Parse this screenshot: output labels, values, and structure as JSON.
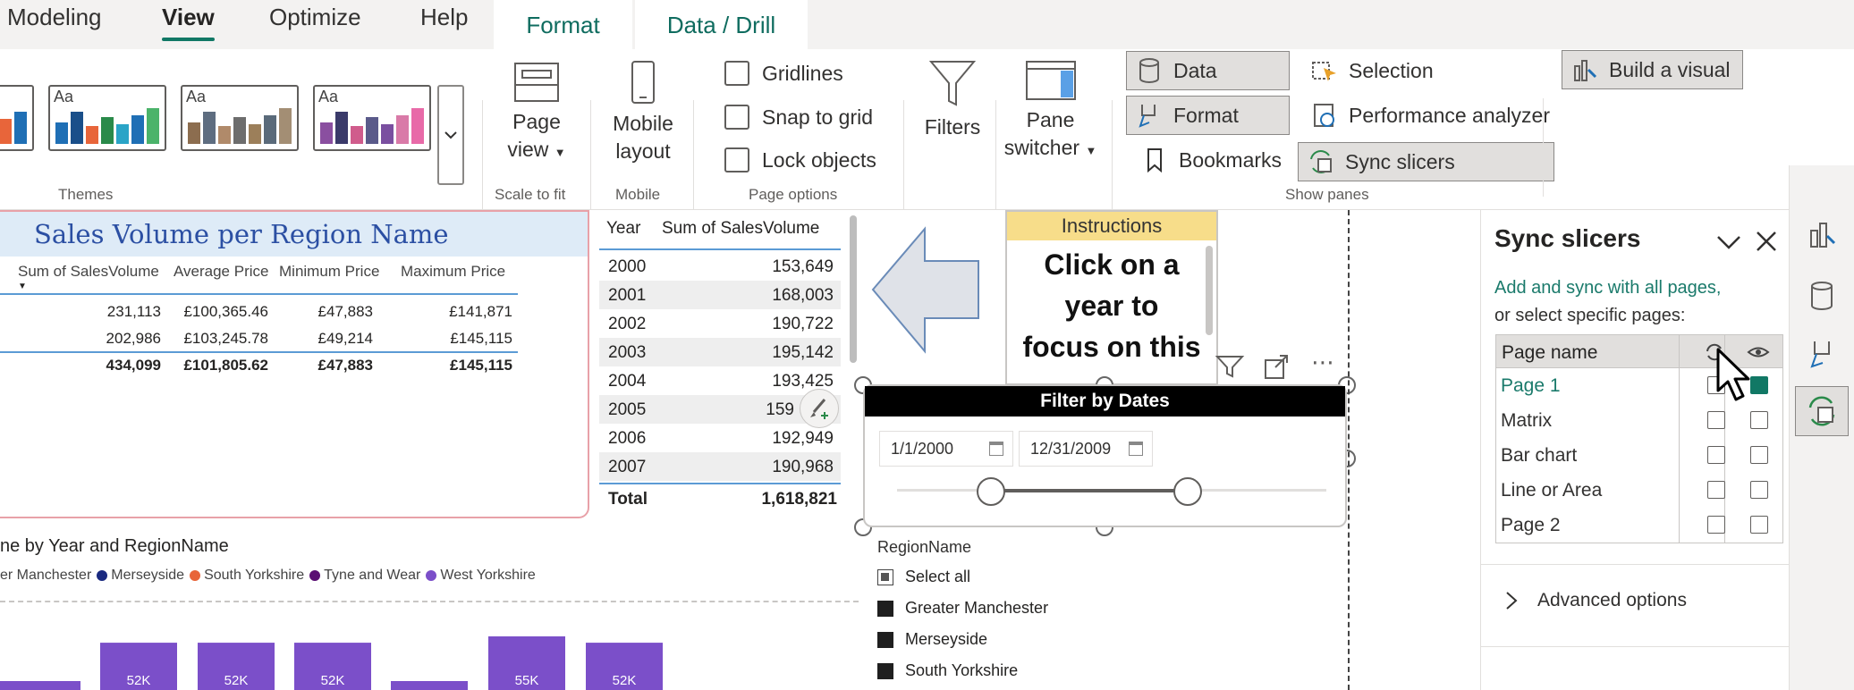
{
  "menu": {
    "tabs": [
      "Modeling",
      "View",
      "Optimize",
      "Help"
    ],
    "context_tabs": [
      "Format",
      "Data / Drill"
    ]
  },
  "ribbon": {
    "groups": {
      "themes": "Themes",
      "scale_to_fit": "Scale to fit",
      "mobile": "Mobile",
      "page_options": "Page options",
      "show_panes": "Show panes"
    },
    "theme_thumb_text": "Aa",
    "page_view": [
      "Page",
      "view"
    ],
    "mobile_layout": [
      "Mobile",
      "layout"
    ],
    "checkboxes": [
      "Gridlines",
      "Snap to grid",
      "Lock objects"
    ],
    "filters": "Filters",
    "pane_switcher": [
      "Pane",
      "switcher"
    ],
    "panes": {
      "data": "Data",
      "format": "Format",
      "bookmarks": "Bookmarks",
      "selection": "Selection",
      "performance": "Performance analyzer",
      "sync_slicers": "Sync slicers",
      "build_visual": "Build a visual"
    }
  },
  "matrix": {
    "title": "Sales Volume per Region Name",
    "headers": [
      "Sum of SalesVolume",
      "Average Price",
      "Minimum Price",
      "Maximum Price"
    ],
    "rows": [
      [
        "231,113",
        "£100,365.46",
        "£47,883",
        "£141,871"
      ],
      [
        "202,986",
        "£103,245.78",
        "£49,214",
        "£145,115"
      ]
    ],
    "total": [
      "434,099",
      "£101,805.62",
      "£47,883",
      "£145,115"
    ]
  },
  "year_table": {
    "headers": [
      "Year",
      "Sum of SalesVolume"
    ],
    "rows": [
      [
        "2000",
        "153,649"
      ],
      [
        "2001",
        "168,003"
      ],
      [
        "2002",
        "190,722"
      ],
      [
        "2003",
        "195,142"
      ],
      [
        "2004",
        "193,425"
      ],
      [
        "2005",
        "159"
      ],
      [
        "2006",
        "192,949"
      ],
      [
        "2007",
        "190,968"
      ]
    ],
    "total_label": "Total",
    "total_value": "1,618,821"
  },
  "instructions": {
    "header": "Instructions",
    "lines": [
      "Click on a",
      "year to",
      "focus on this"
    ]
  },
  "date_slicer": {
    "title": "Filter by Dates",
    "start": "1/1/2000",
    "end": "12/31/2009"
  },
  "region_slicer": {
    "title": "RegionName",
    "items": [
      "Select all",
      "Greater Manchester",
      "Merseyside",
      "South Yorkshire"
    ]
  },
  "bar_chart": {
    "title": "ne by Year and RegionName",
    "legend": [
      "er Manchester",
      "Merseyside",
      "South Yorkshire",
      "Tyne and Wear",
      "West Yorkshire"
    ],
    "legend_colors": [
      "#1a2a80",
      "#1a2a80",
      "#e8653a",
      "#5a0f73",
      "#7b4fc9"
    ],
    "bar_color": "#7b4fc9"
  },
  "chart_data": {
    "type": "bar",
    "title": "ne by Year and RegionName",
    "series": [
      {
        "name": "West Yorkshire",
        "values": [
          null,
          52,
          52,
          52,
          null,
          55,
          52
        ]
      }
    ],
    "data_labels": [
      "",
      "52K",
      "52K",
      "52K",
      "",
      "55K",
      "52K"
    ]
  },
  "sync_pane": {
    "title": "Sync slicers",
    "description": [
      "Add and sync with all pages,",
      "or select specific pages:"
    ],
    "column_header": "Page name",
    "pages": [
      {
        "name": "Page 1",
        "sync": false,
        "visible": true
      },
      {
        "name": "Matrix",
        "sync": false,
        "visible": false
      },
      {
        "name": "Bar chart",
        "sync": false,
        "visible": false
      },
      {
        "name": "Line or Area",
        "sync": false,
        "visible": false
      },
      {
        "name": "Page 2",
        "sync": false,
        "visible": false
      }
    ],
    "advanced": "Advanced options"
  },
  "colors": {
    "accent": "#117865",
    "matrix_title": "#2b4fa3",
    "matrix_title_bg": "#deebf7",
    "instructions_header": "#f7dd8a",
    "bar": "#7b4fc9"
  }
}
